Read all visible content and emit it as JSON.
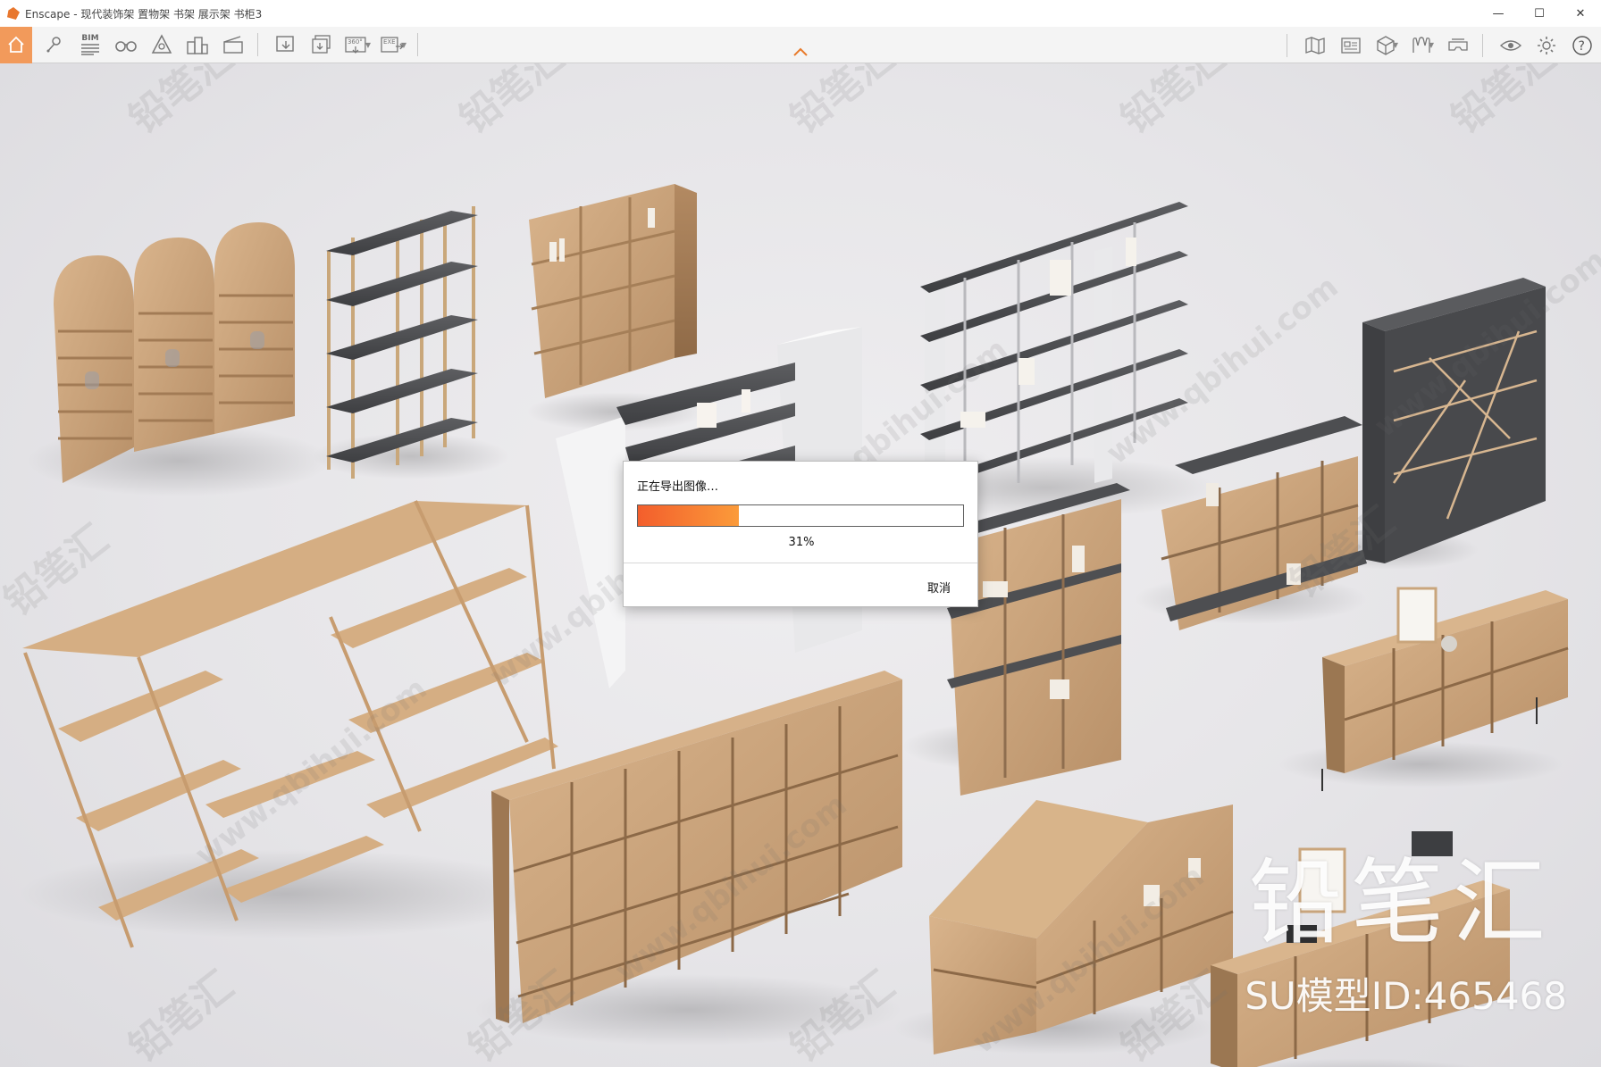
{
  "window": {
    "title": "Enscape - 现代装饰架 置物架 书架 展示架 书柜3",
    "minimize_glyph": "—",
    "maximize_glyph": "☐",
    "close_glyph": "✕"
  },
  "toolbar": {
    "bim_label": "BIM",
    "pano_label": "360°",
    "exe_label": "EXE",
    "help_glyph": "?"
  },
  "watermark": {
    "brand": "铅笔汇",
    "url": "www.qbihui.com",
    "model_id": "SU模型ID:465468"
  },
  "export_dialog": {
    "title": "正在导出图像…",
    "progress_fraction": 0.31,
    "progress_text": "31%",
    "cancel_label": "取消",
    "progress_color_start": "#f35e2c",
    "progress_color_end": "#fb9b3a"
  },
  "colors": {
    "toolbar_home_active": "#f29a5b",
    "toolbar_bg": "#f4f4f4",
    "viewport_bg": "#e6e5e8"
  }
}
